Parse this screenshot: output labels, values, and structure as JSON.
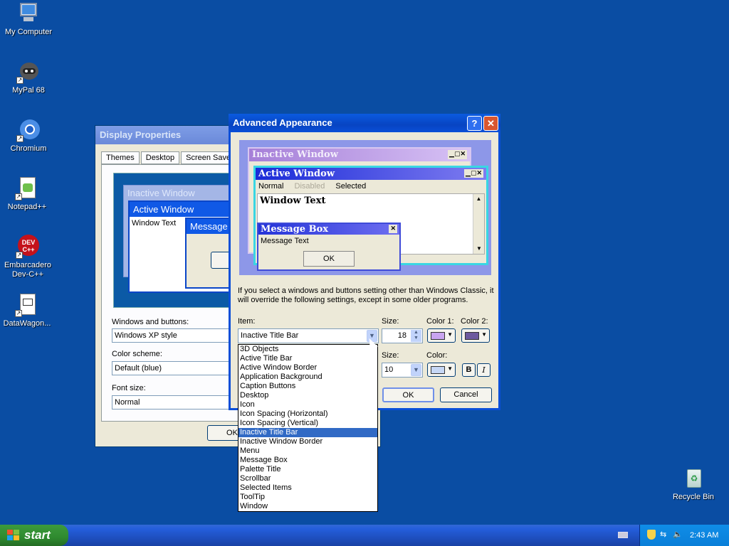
{
  "desktop": {
    "icons": [
      {
        "label": "My Computer",
        "icon": "computer-icon"
      },
      {
        "label": "MyPal 68",
        "icon": "raccoon-browser-icon"
      },
      {
        "label": "Chromium",
        "icon": "chromium-icon"
      },
      {
        "label": "Notepad++",
        "icon": "notepad-plus-plus-icon"
      },
      {
        "label": "Embarcadero Dev-C++",
        "icon": "devcpp-icon",
        "badge": "DEV C++"
      },
      {
        "label": "DataWagon...",
        "icon": "document-icon"
      },
      {
        "label": "Recycle Bin",
        "icon": "recycle-bin-icon"
      }
    ]
  },
  "display_properties": {
    "title": "Display Properties",
    "tabs": [
      "Themes",
      "Desktop",
      "Screen Saver"
    ],
    "preview": {
      "inactive_title": "Inactive Window",
      "active_title": "Active Window",
      "window_text": "Window Text",
      "message_title": "Message"
    },
    "windows_buttons_label": "Windows and buttons:",
    "windows_buttons_value": "Windows XP style",
    "color_scheme_label": "Color scheme:",
    "color_scheme_value": "Default (blue)",
    "font_size_label": "Font size:",
    "font_size_value": "Normal",
    "ok_label": "OK"
  },
  "advanced": {
    "title": "Advanced Appearance",
    "help_glyph": "?",
    "close_glyph": "✕",
    "preview": {
      "inactive_title": "Inactive Window",
      "active_title": "Active Window",
      "menu_normal": "Normal",
      "menu_disabled": "Disabled",
      "menu_selected": "Selected",
      "window_text": "Window Text",
      "message_title": "Message Box",
      "message_text": "Message Text",
      "message_ok": "OK"
    },
    "info_text": "If you select a windows and buttons setting other than Windows Classic, it will override the following settings, except in some older programs.",
    "item_label": "Item:",
    "item_value": "Inactive Title Bar",
    "size_label": "Size:",
    "size_value": "18",
    "color1_label": "Color 1:",
    "color2_label": "Color 2:",
    "font_size_label": "Size:",
    "font_size_value": "10",
    "font_color_label": "Color:",
    "bold_label": "B",
    "italic_label": "I",
    "ok_label": "OK",
    "cancel_label": "Cancel",
    "colors": {
      "color1": "#c9a4f0",
      "color2": "#6d5a9e",
      "font_color": "#c6d7f5"
    }
  },
  "item_dropdown": {
    "options": [
      "3D Objects",
      "Active Title Bar",
      "Active Window Border",
      "Application Background",
      "Caption Buttons",
      "Desktop",
      "Icon",
      "Icon Spacing (Horizontal)",
      "Icon Spacing (Vertical)",
      "Inactive Title Bar",
      "Inactive Window Border",
      "Menu",
      "Message Box",
      "Palette Title",
      "Scrollbar",
      "Selected Items",
      "ToolTip",
      "Window"
    ],
    "selected_index": 9
  },
  "taskbar": {
    "start_label": "start",
    "clock": "2:43 AM"
  }
}
